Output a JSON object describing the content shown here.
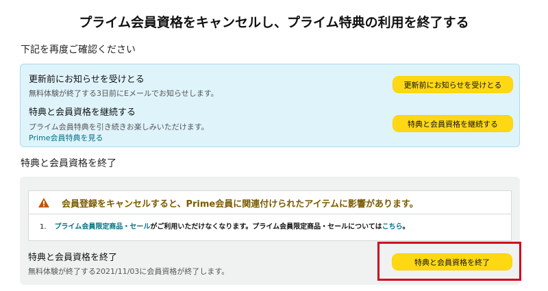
{
  "page_title": "プライム会員資格をキャンセルし、プライム特典の利用を終了する",
  "subtitle": "下記を再度ご確認ください",
  "options": {
    "remind": {
      "title": "更新前にお知らせを受けとる",
      "description": "無料体験が終了する3日前にEメールでお知らせします。",
      "button_label": "更新前にお知らせを受けとる"
    },
    "continue": {
      "title": "特典と会員資格を継続する",
      "description": "プライム会員特典を引き続きお楽しみいただけます。",
      "link_label": "Prime会員特典を見る",
      "button_label": "特典と会員資格を継続する"
    }
  },
  "end_section": {
    "heading": "特典と会員資格を終了",
    "warning": {
      "title": "会員登録をキャンセルすると、Prime会員に関連付けられたアイテムに影響があります。",
      "item_number": "1.",
      "item_link": "プライム会員限定商品・セール",
      "item_text": "がご利用いただけなくなります。プライム会員限定商品・セールについては",
      "item_link2": "こちら",
      "item_end": "。"
    },
    "title": "特典と会員資格を終了",
    "description": "無料体験が終了する2021/11/03に会員資格が終了します。",
    "button_label": "特典と会員資格を終了"
  },
  "colors": {
    "button_bg": "#ffd814",
    "info_bg": "#dff3fb",
    "link": "#007185",
    "warning_icon": "#c45500",
    "highlight": "#d0021b"
  }
}
